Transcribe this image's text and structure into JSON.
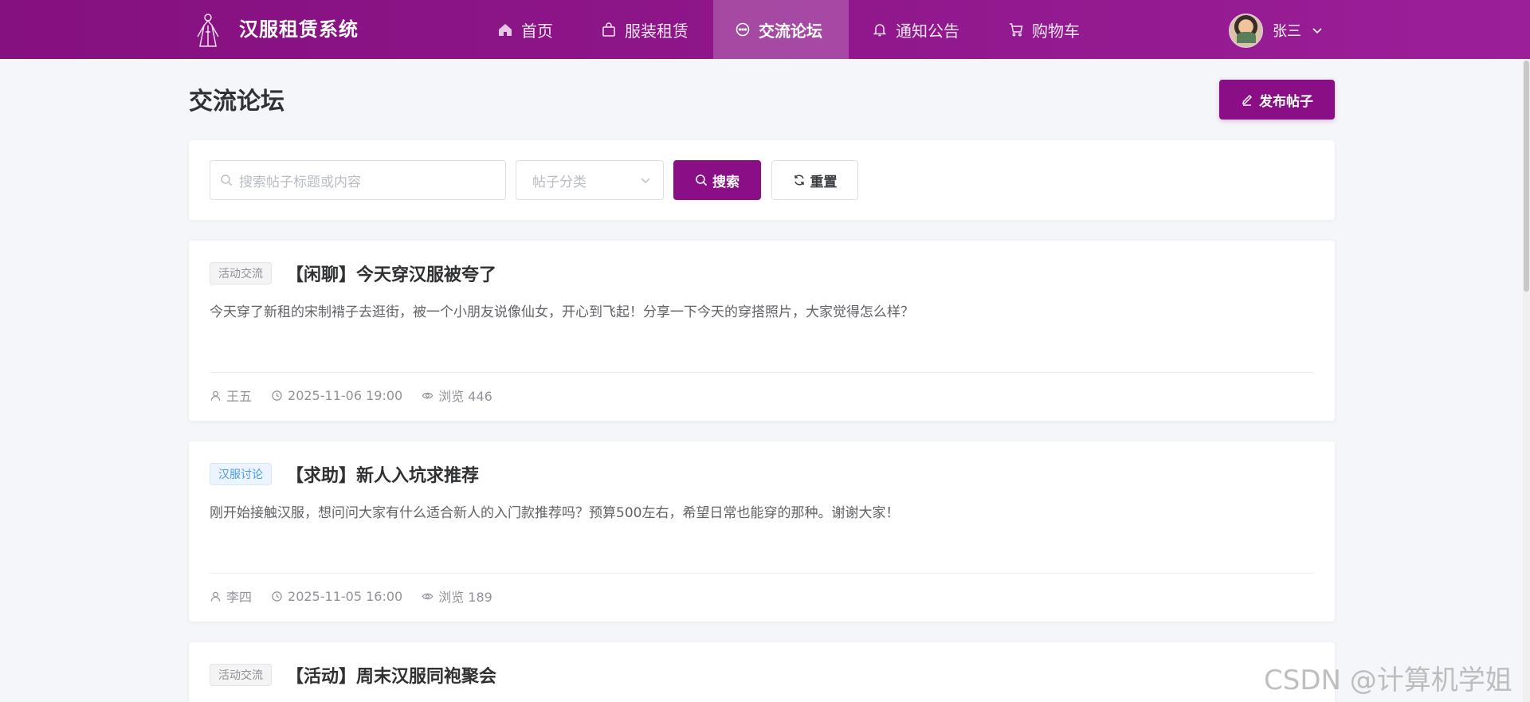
{
  "app": {
    "title": "汉服租赁系统"
  },
  "nav": {
    "items": [
      {
        "label": "首页",
        "icon": "home-icon"
      },
      {
        "label": "服装租赁",
        "icon": "bag-icon"
      },
      {
        "label": "交流论坛",
        "icon": "chat-icon",
        "active": true
      },
      {
        "label": "通知公告",
        "icon": "bell-icon"
      },
      {
        "label": "购物车",
        "icon": "cart-icon"
      }
    ]
  },
  "user": {
    "name": "张三"
  },
  "page": {
    "title": "交流论坛",
    "publish_label": "发布帖子"
  },
  "filter": {
    "search_placeholder": "搜索帖子标题或内容",
    "category_placeholder": "帖子分类",
    "search_label": "搜索",
    "reset_label": "重置"
  },
  "posts": [
    {
      "tag": "活动交流",
      "title": "【闲聊】今天穿汉服被夸了",
      "body": "今天穿了新租的宋制褙子去逛街，被一个小朋友说像仙女，开心到飞起！分享一下今天的穿搭照片，大家觉得怎么样？",
      "author": "王五",
      "time": "2025-11-06 19:00",
      "views": "浏览 446"
    },
    {
      "tag": "汉服讨论",
      "title": "【求助】新人入坑求推荐",
      "body": "刚开始接触汉服，想问问大家有什么适合新人的入门款推荐吗？预算500左右，希望日常也能穿的那种。谢谢大家！",
      "author": "李四",
      "time": "2025-11-05 16:00",
      "views": "浏览 189"
    },
    {
      "tag": "活动交流",
      "title": "【活动】周末汉服同袍聚会"
    }
  ],
  "watermark": "CSDN @计算机学姐",
  "colors": {
    "brand": "#8a0f86",
    "tag_blue": "#4a9af0"
  }
}
